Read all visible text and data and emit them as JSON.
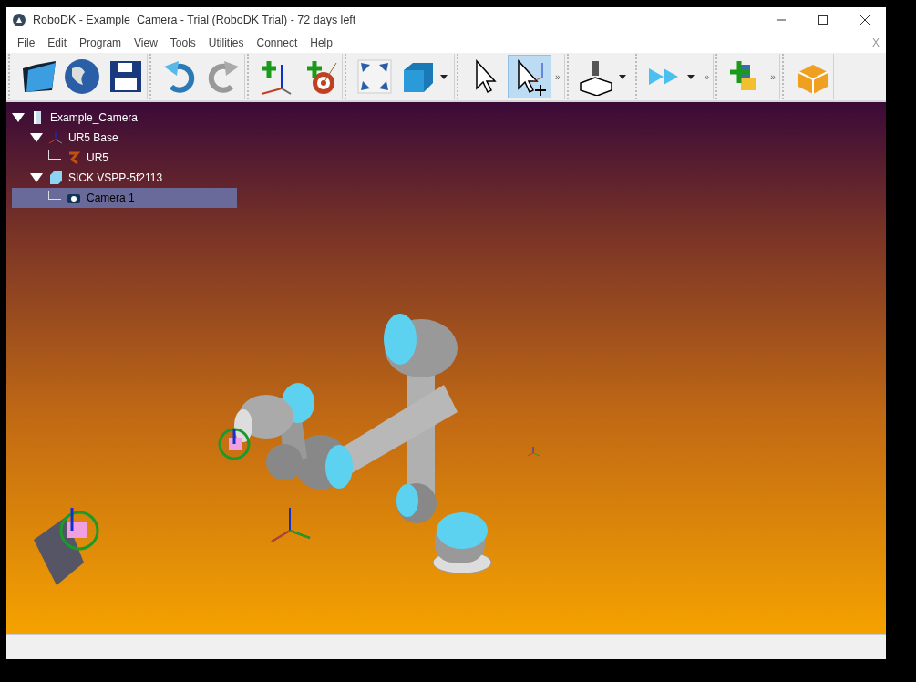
{
  "window": {
    "title": "RoboDK - Example_Camera - Trial (RoboDK Trial) - 72 days left"
  },
  "menu_bar": {
    "items": [
      "File",
      "Edit",
      "Program",
      "View",
      "Tools",
      "Utilities",
      "Connect",
      "Help"
    ],
    "close": "X"
  },
  "toolbar": {
    "groups": [
      {
        "buttons": [
          {
            "selected": false,
            "dropdown": false
          },
          {
            "selected": false,
            "dropdown": false
          },
          {
            "selected": false,
            "dropdown": false
          }
        ]
      },
      {
        "buttons": [
          {
            "selected": false,
            "dropdown": false
          },
          {
            "selected": false,
            "dropdown": false
          }
        ]
      },
      {
        "buttons": [
          {
            "selected": false,
            "dropdown": false
          },
          {
            "selected": false,
            "dropdown": false
          }
        ]
      },
      {
        "buttons": [
          {
            "selected": false,
            "dropdown": false
          },
          {
            "selected": false,
            "dropdown": true
          }
        ]
      },
      {
        "buttons": [
          {
            "selected": false,
            "dropdown": false
          },
          {
            "selected": true,
            "dropdown": false
          }
        ],
        "overflow": "»"
      },
      {
        "buttons": [
          {
            "selected": false,
            "dropdown": true
          }
        ]
      },
      {
        "buttons": [
          {
            "selected": false,
            "dropdown": true
          }
        ],
        "overflow": "»"
      },
      {
        "buttons": [
          {
            "selected": false,
            "dropdown": false
          }
        ],
        "overflow": "»"
      },
      {
        "buttons": [
          {
            "selected": false,
            "dropdown": false
          }
        ]
      }
    ]
  },
  "tree": [
    {
      "label": "Example_Camera",
      "kind": "station",
      "expanded": true,
      "selected": false,
      "children": [
        {
          "label": "UR5 Base",
          "kind": "frame",
          "expanded": true,
          "selected": false,
          "children": [
            {
              "label": "UR5",
              "kind": "robot",
              "selected": false
            }
          ]
        },
        {
          "label": "SICK VSPP-5f2113",
          "kind": "object",
          "expanded": true,
          "selected": false,
          "children": [
            {
              "label": "Camera 1",
              "kind": "camera",
              "selected": true
            }
          ]
        }
      ]
    }
  ]
}
